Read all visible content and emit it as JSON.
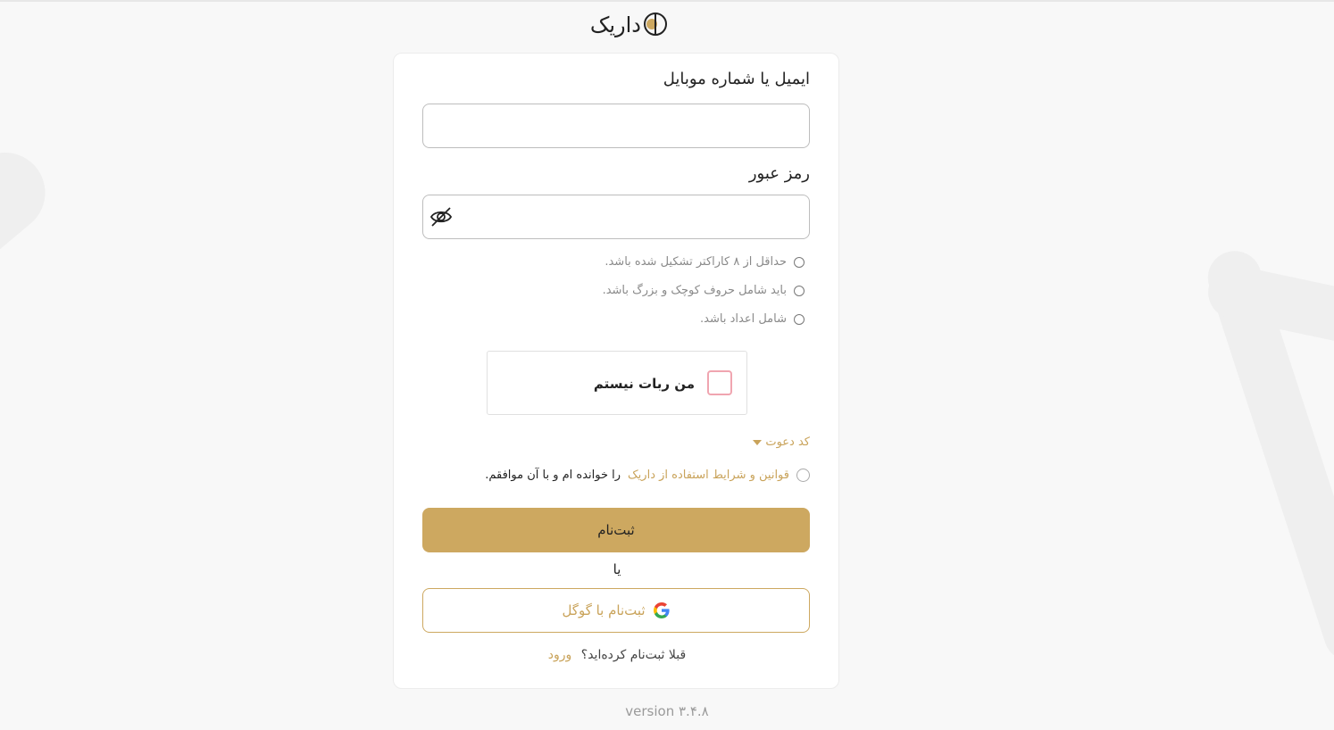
{
  "brand": {
    "logo_text": "داریک",
    "accent_color": "#cda860"
  },
  "form": {
    "email_label": "ایمیل یا شماره موبایل",
    "email_value": "",
    "password_label": "رمز عبور",
    "password_value": "",
    "password_rules": [
      "حداقل از ۸ کاراکتر تشکیل شده باشد.",
      "باید شامل حروف کوچک و بزرگ باشد.",
      "شامل اعداد باشد."
    ],
    "captcha_label": "من ربات نیستم",
    "invite_code_label": "کد دعوت",
    "terms_link": "قوانین و شرایط استفاده از داریک",
    "terms_suffix": "را خوانده ام و با آن موافقم.",
    "submit_label": "ثبت‌نام",
    "or_label": "یا",
    "google_label": "ثبت‌نام با گوگل",
    "already_registered": "قبلا ثبت‌نام کرده‌اید؟",
    "login_label": "ورود"
  },
  "footer": {
    "version": "version ۳.۴.۸"
  },
  "icons": {
    "password_toggle": "eye-off-icon",
    "google": "google-icon"
  }
}
